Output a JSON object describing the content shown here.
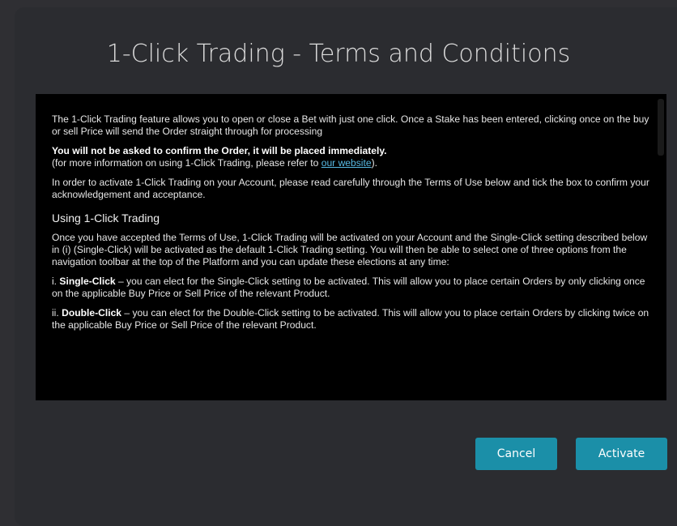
{
  "dialog": {
    "title": "1-Click Trading - Terms and Conditions",
    "intro": "The 1-Click Trading feature allows you to open or close a Bet with just one click. Once a Stake has been entered, clicking once on the buy or sell Price will send the Order straight through for processing",
    "warning": "You will not be asked to confirm the Order, it will be placed immediately.",
    "more_info_prefix": "(for more information on using 1-Click Trading, please refer to ",
    "more_info_link": "our website",
    "more_info_suffix": ").",
    "activate_instruction": "In order to activate 1-Click Trading on your Account, please read carefully through the Terms of Use below and tick the box to confirm your acknowledgement and acceptance.",
    "section_heading": "Using 1-Click Trading",
    "section_text": "Once you have accepted the Terms of Use, 1-Click Trading will be activated on your Account and the Single-Click setting described below in (i) (Single-Click) will be activated as the default 1-Click Trading setting. You will then be able to select one of three options from the navigation toolbar at the top of the Platform and you can update these elections at any time:",
    "items": [
      {
        "marker": "i.",
        "term": "Single-Click",
        "text": " – you can elect for the Single-Click setting to be activated. This will allow you to place certain Orders by only clicking once on the applicable Buy Price or Sell Price of the relevant Product."
      },
      {
        "marker": "ii.",
        "term": "Double-Click",
        "text": " – you can elect for the Double-Click setting to be activated. This will allow you to place certain Orders by clicking twice on the applicable Buy Price or Sell Price of the relevant Product."
      }
    ],
    "cancel_label": "Cancel",
    "activate_label": "Activate"
  }
}
